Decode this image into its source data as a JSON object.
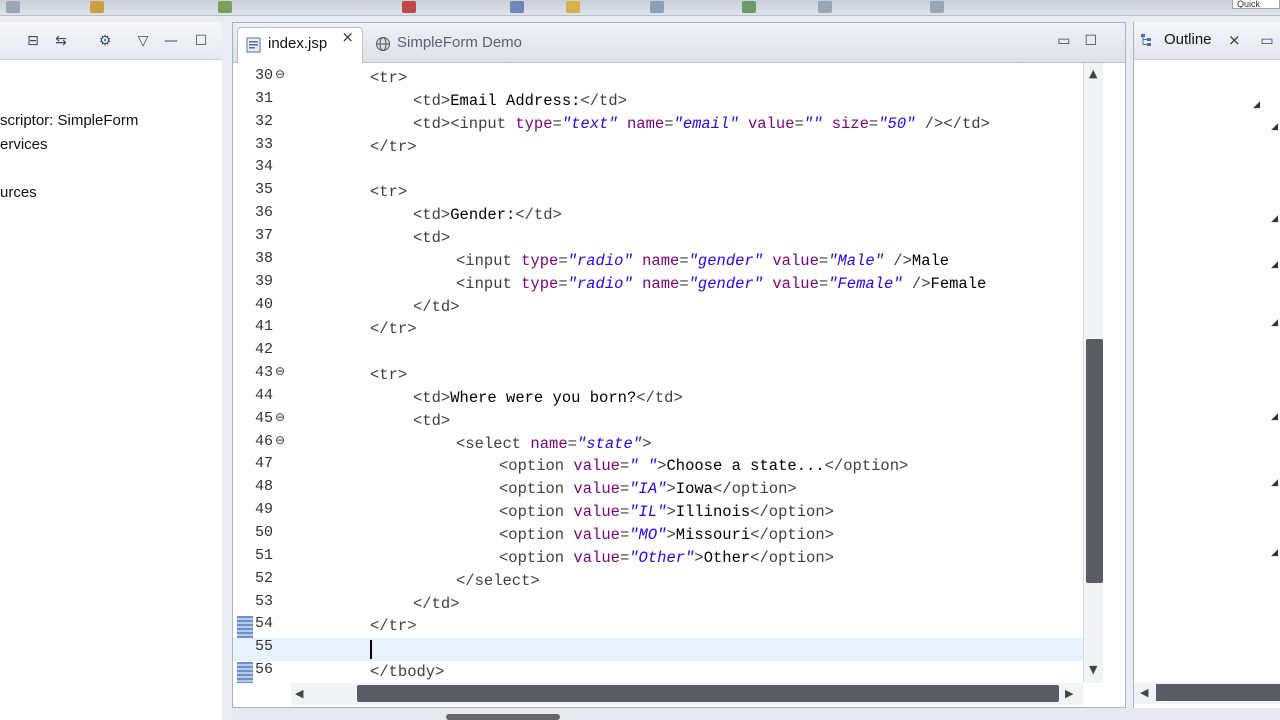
{
  "editor": {
    "tabs": [
      {
        "label": "index.jsp",
        "active": true
      },
      {
        "label": "SimpleForm Demo",
        "active": false
      }
    ],
    "current_line": 55,
    "lines": [
      {
        "n": "30",
        "fold": true,
        "indent": 0,
        "code": [
          [
            "tag",
            "<tr>"
          ]
        ]
      },
      {
        "n": "31",
        "fold": false,
        "indent": 1,
        "code": [
          [
            "tag",
            "<td>"
          ],
          [
            "text",
            "Email Address:"
          ],
          [
            "tag",
            "</td>"
          ]
        ]
      },
      {
        "n": "32",
        "fold": false,
        "indent": 1,
        "code": [
          [
            "tag",
            "<td><input "
          ],
          [
            "attr",
            "type"
          ],
          [
            "tag",
            "="
          ],
          [
            "str",
            "\"text\""
          ],
          [
            "tag",
            " "
          ],
          [
            "attr",
            "name"
          ],
          [
            "tag",
            "="
          ],
          [
            "str",
            "\"email\""
          ],
          [
            "tag",
            " "
          ],
          [
            "attr",
            "value"
          ],
          [
            "tag",
            "="
          ],
          [
            "str",
            "\"\""
          ],
          [
            "tag",
            " "
          ],
          [
            "attr",
            "size"
          ],
          [
            "tag",
            "="
          ],
          [
            "str",
            "\"50\""
          ],
          [
            "tag",
            " /></td>"
          ]
        ]
      },
      {
        "n": "33",
        "fold": false,
        "indent": 0,
        "code": [
          [
            "tag",
            "</tr>"
          ]
        ]
      },
      {
        "n": "34",
        "fold": false,
        "indent": 0,
        "code": []
      },
      {
        "n": "35",
        "fold": false,
        "indent": 0,
        "code": [
          [
            "tag",
            "<tr>"
          ]
        ]
      },
      {
        "n": "36",
        "fold": false,
        "indent": 1,
        "code": [
          [
            "tag",
            "<td>"
          ],
          [
            "text",
            "Gender:"
          ],
          [
            "tag",
            "</td>"
          ]
        ]
      },
      {
        "n": "37",
        "fold": false,
        "indent": 1,
        "code": [
          [
            "tag",
            "<td>"
          ]
        ]
      },
      {
        "n": "38",
        "fold": false,
        "indent": 2,
        "code": [
          [
            "tag",
            "<input "
          ],
          [
            "attr",
            "type"
          ],
          [
            "tag",
            "="
          ],
          [
            "str",
            "\"radio\""
          ],
          [
            "tag",
            " "
          ],
          [
            "attr",
            "name"
          ],
          [
            "tag",
            "="
          ],
          [
            "str",
            "\"gender\""
          ],
          [
            "tag",
            " "
          ],
          [
            "attr",
            "value"
          ],
          [
            "tag",
            "="
          ],
          [
            "str",
            "\"Male\""
          ],
          [
            "tag",
            " />"
          ],
          [
            "text",
            "Male"
          ]
        ]
      },
      {
        "n": "39",
        "fold": false,
        "indent": 2,
        "code": [
          [
            "tag",
            "<input "
          ],
          [
            "attr",
            "type"
          ],
          [
            "tag",
            "="
          ],
          [
            "str",
            "\"radio\""
          ],
          [
            "tag",
            " "
          ],
          [
            "attr",
            "name"
          ],
          [
            "tag",
            "="
          ],
          [
            "str",
            "\"gender\""
          ],
          [
            "tag",
            " "
          ],
          [
            "attr",
            "value"
          ],
          [
            "tag",
            "="
          ],
          [
            "str",
            "\"Female\""
          ],
          [
            "tag",
            " />"
          ],
          [
            "text",
            "Female"
          ]
        ]
      },
      {
        "n": "40",
        "fold": false,
        "indent": 1,
        "code": [
          [
            "tag",
            "</td>"
          ]
        ]
      },
      {
        "n": "41",
        "fold": false,
        "indent": 0,
        "code": [
          [
            "tag",
            "</tr>"
          ]
        ]
      },
      {
        "n": "42",
        "fold": false,
        "indent": 0,
        "code": []
      },
      {
        "n": "43",
        "fold": true,
        "indent": 0,
        "code": [
          [
            "tag",
            "<tr>"
          ]
        ]
      },
      {
        "n": "44",
        "fold": false,
        "indent": 1,
        "code": [
          [
            "tag",
            "<td>"
          ],
          [
            "text",
            "Where were you born?"
          ],
          [
            "tag",
            "</td>"
          ]
        ]
      },
      {
        "n": "45",
        "fold": true,
        "indent": 1,
        "code": [
          [
            "tag",
            "<td>"
          ]
        ]
      },
      {
        "n": "46",
        "fold": true,
        "indent": 2,
        "code": [
          [
            "tag",
            "<select "
          ],
          [
            "attr",
            "name"
          ],
          [
            "tag",
            "="
          ],
          [
            "str",
            "\"state\""
          ],
          [
            "tag",
            ">"
          ]
        ]
      },
      {
        "n": "47",
        "fold": false,
        "indent": 3,
        "code": [
          [
            "tag",
            "<option "
          ],
          [
            "attr",
            "value"
          ],
          [
            "tag",
            "="
          ],
          [
            "str",
            "\" \""
          ],
          [
            "tag",
            ">"
          ],
          [
            "text",
            "Choose a state..."
          ],
          [
            "tag",
            "</option>"
          ]
        ]
      },
      {
        "n": "48",
        "fold": false,
        "indent": 3,
        "code": [
          [
            "tag",
            "<option "
          ],
          [
            "attr",
            "value"
          ],
          [
            "tag",
            "="
          ],
          [
            "str",
            "\"IA\""
          ],
          [
            "tag",
            ">"
          ],
          [
            "text",
            "Iowa"
          ],
          [
            "tag",
            "</option>"
          ]
        ]
      },
      {
        "n": "49",
        "fold": false,
        "indent": 3,
        "code": [
          [
            "tag",
            "<option "
          ],
          [
            "attr",
            "value"
          ],
          [
            "tag",
            "="
          ],
          [
            "str",
            "\"IL\""
          ],
          [
            "tag",
            ">"
          ],
          [
            "text",
            "Illinois"
          ],
          [
            "tag",
            "</option>"
          ]
        ]
      },
      {
        "n": "50",
        "fold": false,
        "indent": 3,
        "code": [
          [
            "tag",
            "<option "
          ],
          [
            "attr",
            "value"
          ],
          [
            "tag",
            "="
          ],
          [
            "str",
            "\"MO\""
          ],
          [
            "tag",
            ">"
          ],
          [
            "text",
            "Missouri"
          ],
          [
            "tag",
            "</option>"
          ]
        ]
      },
      {
        "n": "51",
        "fold": false,
        "indent": 3,
        "code": [
          [
            "tag",
            "<option "
          ],
          [
            "attr",
            "value"
          ],
          [
            "tag",
            "="
          ],
          [
            "str",
            "\"Other\""
          ],
          [
            "tag",
            ">"
          ],
          [
            "text",
            "Other"
          ],
          [
            "tag",
            "</option>"
          ]
        ]
      },
      {
        "n": "52",
        "fold": false,
        "indent": 2,
        "code": [
          [
            "tag",
            "</select>"
          ]
        ]
      },
      {
        "n": "53",
        "fold": false,
        "indent": 1,
        "code": [
          [
            "tag",
            "</td>"
          ]
        ]
      },
      {
        "n": "54",
        "fold": false,
        "indent": 0,
        "code": [
          [
            "tag",
            "</tr>"
          ]
        ]
      },
      {
        "n": "55",
        "fold": false,
        "indent": 0,
        "code": []
      },
      {
        "n": "56",
        "fold": false,
        "indent": 0,
        "code": [
          [
            "tag",
            "</tbody>"
          ]
        ]
      }
    ]
  },
  "left_panel": {
    "items": [
      "scriptor: SimpleForm",
      "ervices",
      "urces"
    ]
  },
  "outline": {
    "title": "Outline"
  },
  "toolbar": {
    "quick_access": "Quick"
  },
  "icons": {
    "tab_close": "×",
    "minimize": "▭",
    "maximize": "☐"
  },
  "colors": {
    "tag": "#3f3f3f",
    "attribute": "#7f007f",
    "string": "#2a00ff",
    "current_line": "#e8f2fe"
  }
}
